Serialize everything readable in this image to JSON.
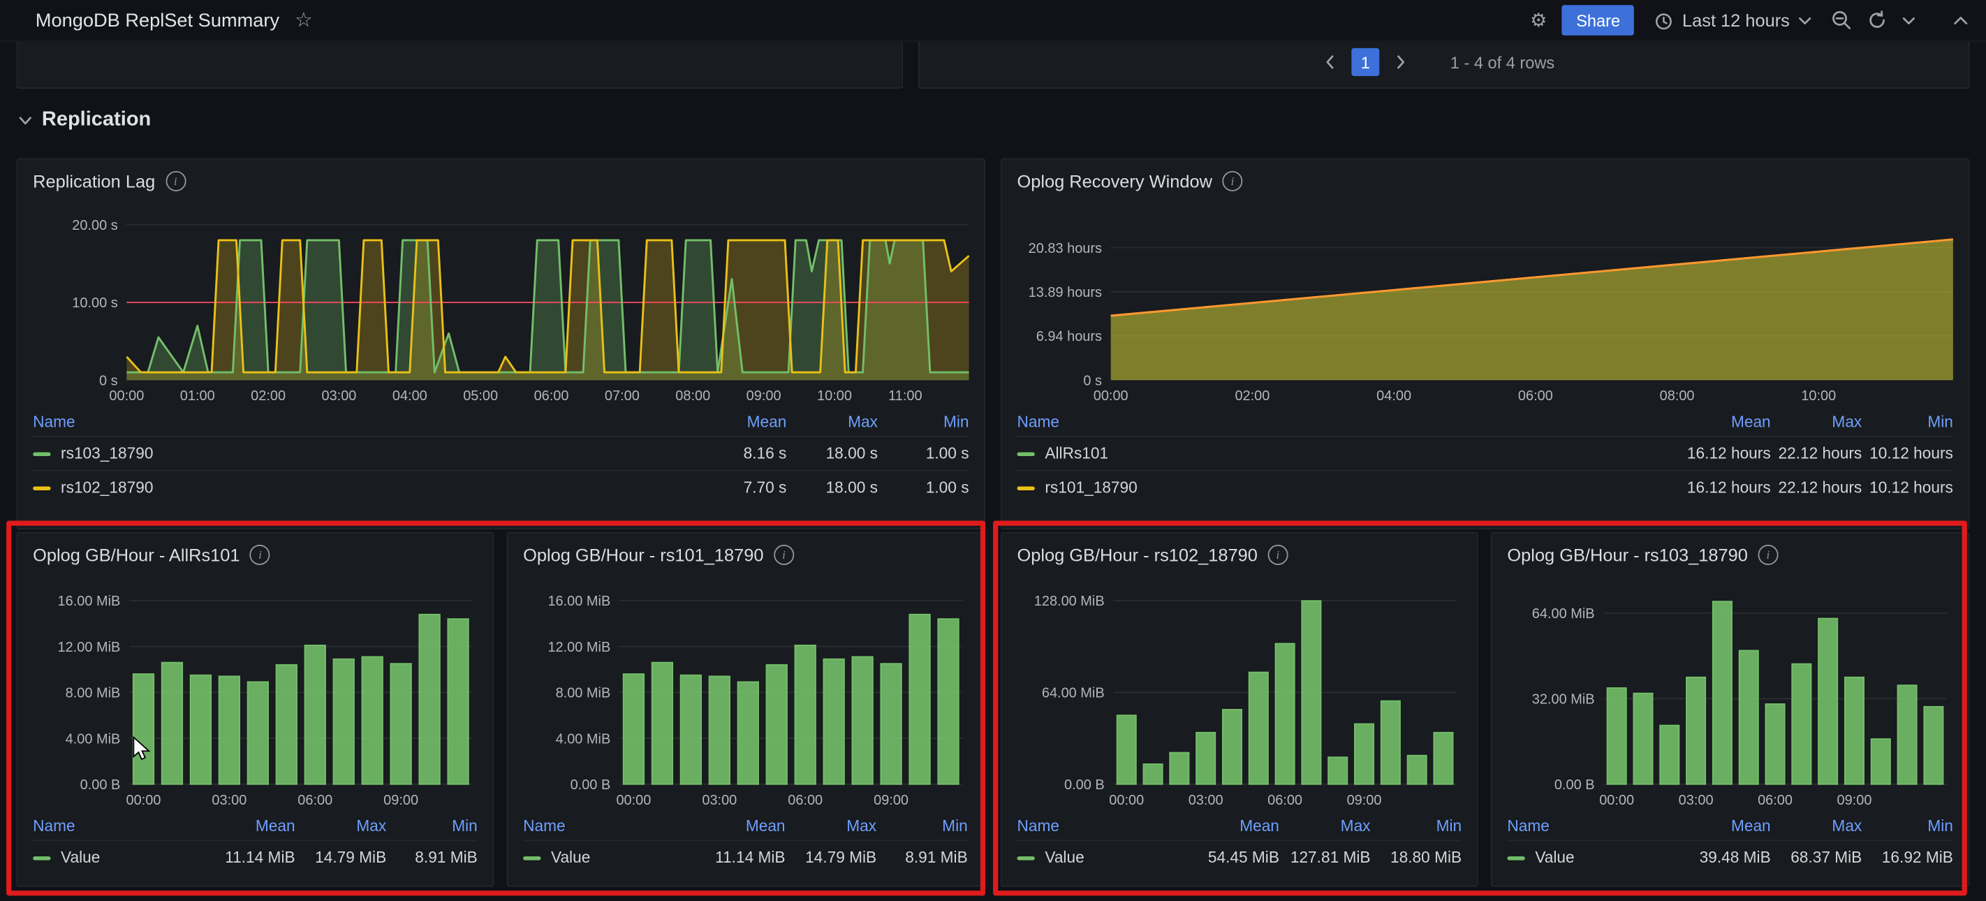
{
  "colors": {
    "accent_blue": "#3d71d9",
    "series_green": "#73bf69",
    "series_yellow": "#eac117",
    "series_orange": "#ff9830",
    "threshold_red": "#f2495c",
    "annotation_red": "#df1b1b"
  },
  "topbar": {
    "title": "MongoDB ReplSet Summary",
    "share_label": "Share",
    "time_range_label": "Last 12 hours"
  },
  "toprow": {
    "page": "1",
    "rows_info": "1 - 4 of 4 rows"
  },
  "section": {
    "title": "Replication"
  },
  "replication_lag": {
    "title": "Replication Lag",
    "chart": {
      "type": "line",
      "y_max": 21.2,
      "x_max": 11.9,
      "y_ticks": [
        {
          "label": "20.00 s",
          "v": 20
        },
        {
          "label": "10.00 s",
          "v": 10
        },
        {
          "label": "0 s",
          "v": 0
        }
      ],
      "x_ticks": [
        {
          "label": "00:00",
          "h": 0
        },
        {
          "label": "01:00",
          "h": 1
        },
        {
          "label": "02:00",
          "h": 2
        },
        {
          "label": "03:00",
          "h": 3
        },
        {
          "label": "04:00",
          "h": 4
        },
        {
          "label": "05:00",
          "h": 5
        },
        {
          "label": "06:00",
          "h": 6
        },
        {
          "label": "07:00",
          "h": 7
        },
        {
          "label": "08:00",
          "h": 8
        },
        {
          "label": "09:00",
          "h": 9
        },
        {
          "label": "10:00",
          "h": 10
        },
        {
          "label": "11:00",
          "h": 11
        }
      ],
      "threshold": {
        "v": 10,
        "color": "#f2495c"
      },
      "series": [
        {
          "name": "rs103_18790",
          "color": "#73bf69",
          "fill_opacity": 0.28,
          "points": [
            [
              0,
              1
            ],
            [
              0.3,
              1
            ],
            [
              0.45,
              5.5
            ],
            [
              0.8,
              1
            ],
            [
              1.0,
              7
            ],
            [
              1.15,
              1
            ],
            [
              1.5,
              1
            ],
            [
              1.6,
              18
            ],
            [
              1.9,
              18
            ],
            [
              2.0,
              1
            ],
            [
              2.45,
              1
            ],
            [
              2.55,
              18
            ],
            [
              3.0,
              18
            ],
            [
              3.1,
              1
            ],
            [
              3.8,
              1
            ],
            [
              3.9,
              18
            ],
            [
              4.25,
              18
            ],
            [
              4.35,
              1
            ],
            [
              4.55,
              6
            ],
            [
              4.7,
              1
            ],
            [
              5.7,
              1
            ],
            [
              5.8,
              18
            ],
            [
              6.1,
              18
            ],
            [
              6.2,
              1
            ],
            [
              6.45,
              1
            ],
            [
              6.55,
              18
            ],
            [
              6.95,
              18
            ],
            [
              7.05,
              1
            ],
            [
              7.8,
              1
            ],
            [
              7.9,
              18
            ],
            [
              8.25,
              18
            ],
            [
              8.35,
              1
            ],
            [
              8.55,
              13
            ],
            [
              8.7,
              1
            ],
            [
              9.35,
              1
            ],
            [
              9.45,
              18
            ],
            [
              9.6,
              18
            ],
            [
              9.68,
              14
            ],
            [
              9.78,
              18
            ],
            [
              10.1,
              18
            ],
            [
              10.2,
              1
            ],
            [
              10.4,
              1
            ],
            [
              10.5,
              18
            ],
            [
              10.72,
              18
            ],
            [
              10.78,
              15
            ],
            [
              10.85,
              18
            ],
            [
              11.25,
              18
            ],
            [
              11.35,
              1
            ],
            [
              11.9,
              1
            ]
          ]
        },
        {
          "name": "rs102_18790",
          "color": "#eac117",
          "fill_opacity": 0.25,
          "points": [
            [
              0,
              3
            ],
            [
              0.2,
              1
            ],
            [
              1.2,
              1
            ],
            [
              1.3,
              18
            ],
            [
              1.55,
              18
            ],
            [
              1.65,
              1
            ],
            [
              2.1,
              1
            ],
            [
              2.2,
              18
            ],
            [
              2.45,
              18
            ],
            [
              2.55,
              1
            ],
            [
              3.25,
              1
            ],
            [
              3.35,
              18
            ],
            [
              3.6,
              18
            ],
            [
              3.7,
              1
            ],
            [
              4.0,
              1
            ],
            [
              4.1,
              18
            ],
            [
              4.4,
              18
            ],
            [
              4.5,
              1
            ],
            [
              5.25,
              1
            ],
            [
              5.35,
              3
            ],
            [
              5.5,
              1
            ],
            [
              6.2,
              1
            ],
            [
              6.3,
              18
            ],
            [
              6.65,
              18
            ],
            [
              6.75,
              1
            ],
            [
              7.25,
              1
            ],
            [
              7.35,
              18
            ],
            [
              7.7,
              18
            ],
            [
              7.8,
              1
            ],
            [
              8.4,
              1
            ],
            [
              8.5,
              18
            ],
            [
              9.3,
              18
            ],
            [
              9.4,
              1
            ],
            [
              9.8,
              1
            ],
            [
              9.9,
              18
            ],
            [
              10.05,
              18
            ],
            [
              10.15,
              1
            ],
            [
              10.3,
              1
            ],
            [
              10.4,
              18
            ],
            [
              11.55,
              18
            ],
            [
              11.65,
              14
            ],
            [
              11.9,
              16
            ]
          ]
        }
      ]
    },
    "legend": {
      "headers": [
        "Name",
        "Mean",
        "Max",
        "Min"
      ],
      "rows": [
        {
          "name": "rs103_18790",
          "color": "#73bf69",
          "mean": "8.16 s",
          "max": "18.00 s",
          "min": "1.00 s"
        },
        {
          "name": "rs102_18790",
          "color": "#eac117",
          "mean": "7.70 s",
          "max": "18.00 s",
          "min": "1.00 s"
        }
      ]
    }
  },
  "oplog_recovery": {
    "title": "Oplog Recovery Window",
    "chart": {
      "type": "area",
      "y_max": 25.9,
      "x_max": 11.9,
      "line_color": "#ff9830",
      "y_ticks": [
        {
          "label": "20.83 hours",
          "v": 20.83
        },
        {
          "label": "13.89 hours",
          "v": 13.89
        },
        {
          "label": "6.94 hours",
          "v": 6.94
        },
        {
          "label": "0 s",
          "v": 0
        }
      ],
      "x_ticks": [
        {
          "label": "00:00",
          "h": 0
        },
        {
          "label": "02:00",
          "h": 2
        },
        {
          "label": "04:00",
          "h": 4
        },
        {
          "label": "06:00",
          "h": 6
        },
        {
          "label": "08:00",
          "h": 8
        },
        {
          "label": "10:00",
          "h": 10
        }
      ],
      "series": [
        {
          "name": "AllRs101",
          "color": "#73bf69",
          "fill_opacity": 0.35,
          "points": [
            [
              0,
              10.12
            ],
            [
              11.9,
              22.12
            ]
          ]
        },
        {
          "name": "rs101_18790",
          "color": "#eac117",
          "fill_opacity": 0.4,
          "points": [
            [
              0,
              10.12
            ],
            [
              11.9,
              22.12
            ]
          ]
        }
      ]
    },
    "legend": {
      "headers": [
        "Name",
        "Mean",
        "Max",
        "Min"
      ],
      "rows": [
        {
          "name": "AllRs101",
          "color": "#73bf69",
          "mean": "16.12 hours",
          "max": "22.12 hours",
          "min": "10.12 hours"
        },
        {
          "name": "rs101_18790",
          "color": "#eac117",
          "mean": "16.12 hours",
          "max": "22.12 hours",
          "min": "10.12 hours"
        }
      ]
    }
  },
  "oplog": [
    {
      "title": "Oplog GB/Hour - AllRs101",
      "chart": {
        "type": "bar",
        "bar_color": "#73bf69",
        "y_max": 17,
        "y_ticks": [
          {
            "label": "16.00 MiB",
            "v": 16
          },
          {
            "label": "12.00 MiB",
            "v": 12
          },
          {
            "label": "8.00 MiB",
            "v": 8
          },
          {
            "label": "4.00 MiB",
            "v": 4
          },
          {
            "label": "0.00 B",
            "v": 0
          }
        ],
        "x_ticks": [
          {
            "label": "00:00",
            "i": 0
          },
          {
            "label": "03:00",
            "i": 3
          },
          {
            "label": "06:00",
            "i": 6
          },
          {
            "label": "09:00",
            "i": 9
          }
        ],
        "values": [
          9.6,
          10.6,
          9.5,
          9.4,
          8.91,
          10.4,
          12.1,
          10.9,
          11.1,
          10.5,
          14.79,
          14.4
        ]
      },
      "legend": {
        "headers": [
          "Name",
          "Mean",
          "Max",
          "Min"
        ],
        "name": "Value",
        "mean": "11.14 MiB",
        "max": "14.79 MiB",
        "min": "8.91 MiB"
      }
    },
    {
      "title": "Oplog GB/Hour - rs101_18790",
      "chart": {
        "type": "bar",
        "bar_color": "#73bf69",
        "y_max": 17,
        "y_ticks": [
          {
            "label": "16.00 MiB",
            "v": 16
          },
          {
            "label": "12.00 MiB",
            "v": 12
          },
          {
            "label": "8.00 MiB",
            "v": 8
          },
          {
            "label": "4.00 MiB",
            "v": 4
          },
          {
            "label": "0.00 B",
            "v": 0
          }
        ],
        "x_ticks": [
          {
            "label": "00:00",
            "i": 0
          },
          {
            "label": "03:00",
            "i": 3
          },
          {
            "label": "06:00",
            "i": 6
          },
          {
            "label": "09:00",
            "i": 9
          }
        ],
        "values": [
          9.6,
          10.6,
          9.5,
          9.4,
          8.91,
          10.4,
          12.1,
          10.9,
          11.1,
          10.5,
          14.79,
          14.4
        ]
      },
      "legend": {
        "headers": [
          "Name",
          "Mean",
          "Max",
          "Min"
        ],
        "name": "Value",
        "mean": "11.14 MiB",
        "max": "14.79 MiB",
        "min": "8.91 MiB"
      }
    },
    {
      "title": "Oplog GB/Hour - rs102_18790",
      "chart": {
        "type": "bar",
        "bar_color": "#73bf69",
        "y_max": 136,
        "y_ticks": [
          {
            "label": "128.00 MiB",
            "v": 128
          },
          {
            "label": "64.00 MiB",
            "v": 64
          },
          {
            "label": "0.00 B",
            "v": 0
          }
        ],
        "x_ticks": [
          {
            "label": "00:00",
            "i": 0
          },
          {
            "label": "03:00",
            "i": 3
          },
          {
            "label": "06:00",
            "i": 6
          },
          {
            "label": "09:00",
            "i": 9
          }
        ],
        "values": [
          48,
          14,
          22,
          36,
          52,
          78,
          98,
          127.81,
          18.8,
          42,
          58,
          20,
          36
        ]
      },
      "legend": {
        "headers": [
          "Name",
          "Mean",
          "Max",
          "Min"
        ],
        "name": "Value",
        "mean": "54.45 MiB",
        "max": "127.81 MiB",
        "min": "18.80 MiB"
      }
    },
    {
      "title": "Oplog GB/Hour - rs103_18790",
      "chart": {
        "type": "bar",
        "bar_color": "#73bf69",
        "y_max": 73,
        "y_ticks": [
          {
            "label": "64.00 MiB",
            "v": 64
          },
          {
            "label": "32.00 MiB",
            "v": 32
          },
          {
            "label": "0.00 B",
            "v": 0
          }
        ],
        "x_ticks": [
          {
            "label": "00:00",
            "i": 0
          },
          {
            "label": "03:00",
            "i": 3
          },
          {
            "label": "06:00",
            "i": 6
          },
          {
            "label": "09:00",
            "i": 9
          }
        ],
        "values": [
          36,
          34,
          22,
          40,
          68.37,
          50,
          30,
          45,
          62,
          40,
          16.92,
          37,
          29
        ]
      },
      "legend": {
        "headers": [
          "Name",
          "Mean",
          "Max",
          "Min"
        ],
        "name": "Value",
        "mean": "39.48 MiB",
        "max": "68.37 MiB",
        "min": "16.92 MiB"
      }
    }
  ]
}
